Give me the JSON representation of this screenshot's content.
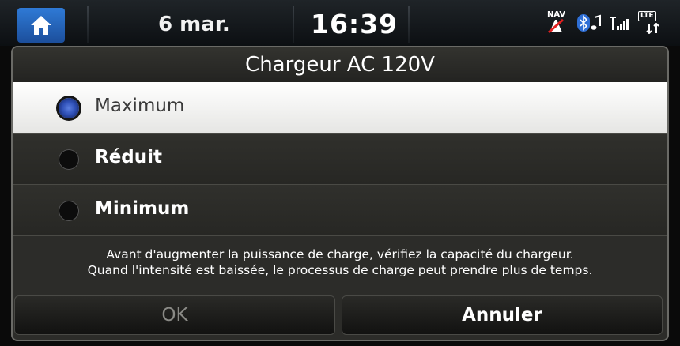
{
  "status_bar": {
    "date": "6 mar.",
    "time": "16:39",
    "nav_label": "NAV",
    "lte_label": "LTE",
    "icons": [
      "home-icon",
      "nav-off-icon",
      "bluetooth-audio-icon",
      "signal-icon",
      "lte-icon"
    ]
  },
  "dialog": {
    "title": "Chargeur AC 120V",
    "options": [
      {
        "label": "Maximum",
        "selected": true
      },
      {
        "label": "Réduit",
        "selected": false
      },
      {
        "label": "Minimum",
        "selected": false
      }
    ],
    "note_line1": "Avant d'augmenter la puissance de charge, vérifiez la capacité du chargeur.",
    "note_line2": "Quand l'intensité est baissée, le processus de charge peut prendre plus de temps.",
    "ok_label": "OK",
    "ok_enabled": false,
    "cancel_label": "Annuler"
  },
  "colors": {
    "home_button": "#2f7ad6",
    "selected_radio": "#2e4fb6",
    "dialog_bg": "#2c2c29"
  }
}
